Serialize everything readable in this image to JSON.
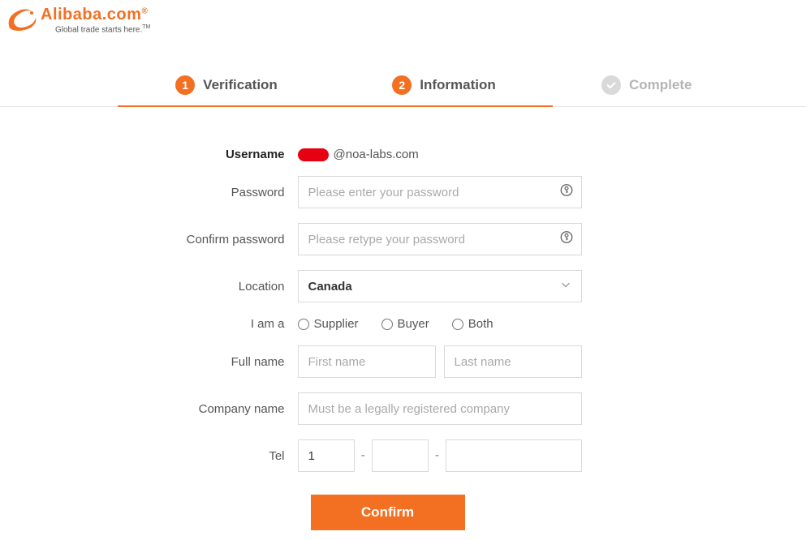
{
  "logo": {
    "brand": "Alibaba",
    "domain": ".com",
    "tagline": "Global trade starts here.",
    "tm": "TM"
  },
  "steps": {
    "verification": {
      "num": "1",
      "label": "Verification"
    },
    "information": {
      "num": "2",
      "label": "Information"
    },
    "complete": {
      "label": "Complete"
    }
  },
  "form": {
    "username_label": "Username",
    "username_domain": "@noa-labs.com",
    "password_label": "Password",
    "password_placeholder": "Please enter your password",
    "confirm_pw_label": "Confirm password",
    "confirm_pw_placeholder": "Please retype your password",
    "location_label": "Location",
    "location_value": "Canada",
    "role_label": "I am a",
    "role_options": {
      "supplier": "Supplier",
      "buyer": "Buyer",
      "both": "Both"
    },
    "fullname_label": "Full name",
    "firstname_placeholder": "First name",
    "lastname_placeholder": "Last name",
    "company_label": "Company name",
    "company_placeholder": "Must be a legally registered company",
    "tel_label": "Tel",
    "tel_cc_value": "1",
    "confirm_button": "Confirm"
  }
}
